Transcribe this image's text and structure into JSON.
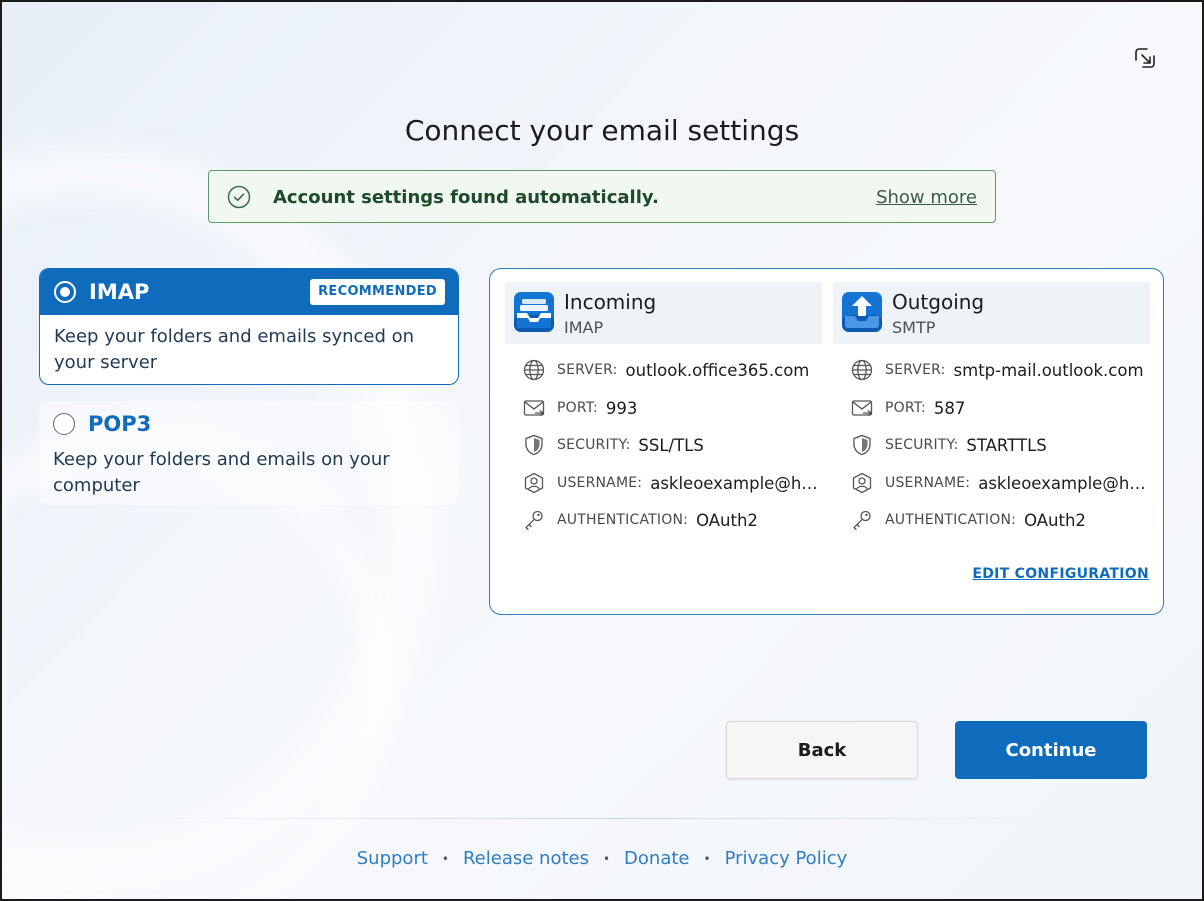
{
  "page": {
    "title": "Connect your email settings"
  },
  "banner": {
    "message": "Account settings found automatically.",
    "show_more": "Show more"
  },
  "protocols": {
    "imap": {
      "name": "IMAP",
      "badge": "RECOMMENDED",
      "description": "Keep your folders and emails synced on your server",
      "selected": true
    },
    "pop3": {
      "name": "POP3",
      "description": "Keep your folders and emails on your computer",
      "selected": false
    }
  },
  "incoming": {
    "title": "Incoming",
    "subtitle": "IMAP",
    "server_label": "SERVER:",
    "server": "outlook.office365.com",
    "port_label": "PORT:",
    "port": "993",
    "security_label": "SECURITY:",
    "security": "SSL/TLS",
    "username_label": "USERNAME:",
    "username": "askleoexample@ho...",
    "auth_label": "AUTHENTICATION:",
    "auth": "OAuth2"
  },
  "outgoing": {
    "title": "Outgoing",
    "subtitle": "SMTP",
    "server_label": "SERVER:",
    "server": "smtp-mail.outlook.com",
    "port_label": "PORT:",
    "port": "587",
    "security_label": "SECURITY:",
    "security": "STARTTLS",
    "username_label": "USERNAME:",
    "username": "askleoexample@ho...",
    "auth_label": "AUTHENTICATION:",
    "auth": "OAuth2"
  },
  "edit_configuration": "EDIT CONFIGURATION",
  "buttons": {
    "back": "Back",
    "continue": "Continue"
  },
  "footer": {
    "support": "Support",
    "release_notes": "Release notes",
    "donate": "Donate",
    "privacy": "Privacy Policy",
    "separator": "•"
  },
  "colors": {
    "accent": "#0f6cbd",
    "success_border": "#5f9a6b",
    "success_text": "#1d4a2a"
  },
  "icons": [
    "resize-icon",
    "check-circle-icon",
    "incoming-tray-icon",
    "outgoing-upload-icon",
    "globe-icon",
    "mail-port-icon",
    "shield-icon",
    "user-icon",
    "key-icon"
  ]
}
